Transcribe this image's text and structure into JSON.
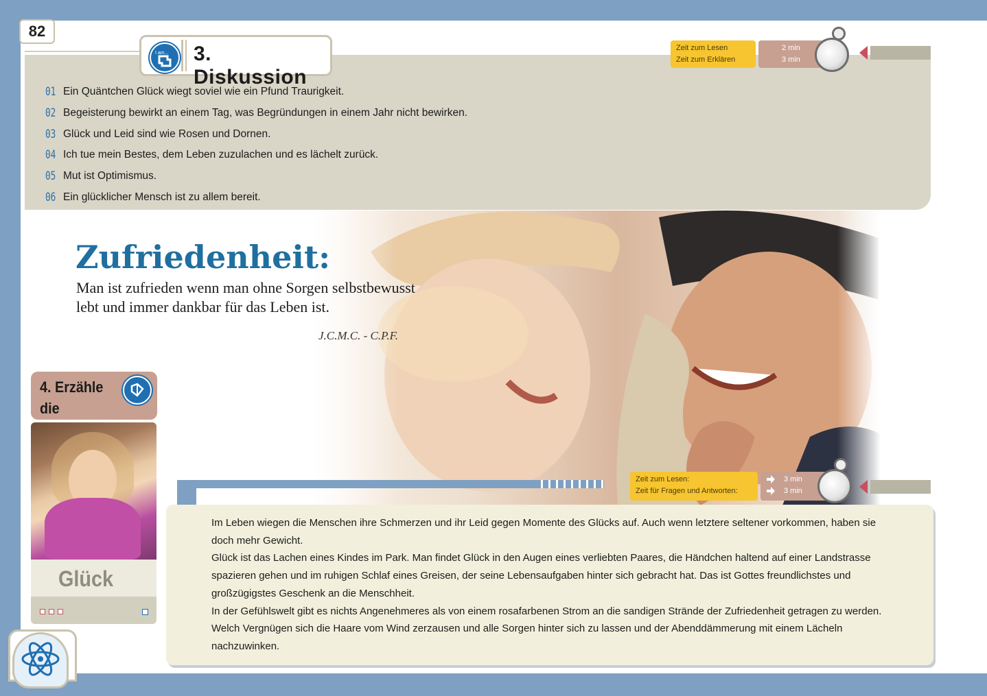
{
  "page_number": "82",
  "header": {
    "badge_icon_text": "I am...",
    "title": "3. Diskussion"
  },
  "timer_top": {
    "labels": [
      "Zeit zum Lesen",
      "Zeit zum Erklären"
    ],
    "values": [
      "2 min",
      "3 min"
    ]
  },
  "discussion_items": [
    {
      "num": "01",
      "text": "Ein Quäntchen Glück wiegt soviel wie ein Pfund Traurigkeit."
    },
    {
      "num": "02",
      "text": "Begeisterung bewirkt an einem Tag, was Begründungen in einem Jahr nicht bewirken."
    },
    {
      "num": "03",
      "text": "Glück und Leid sind wie Rosen und Dornen."
    },
    {
      "num": "04",
      "text": "Ich tue mein Bestes, dem Leben zuzulachen und es lächelt zurück."
    },
    {
      "num": "05",
      "text": "Mut ist Optimismus."
    },
    {
      "num": "06",
      "text": "Ein glücklicher Mensch ist zu allem bereit."
    }
  ],
  "quote": {
    "title": "Zufriedenheit:",
    "body": "Man ist zufrieden wenn man ohne Sorgen selbstbewusst lebt und immer dankbar für das Leben ist.",
    "author": "J.C.M.C. - C.P.F."
  },
  "story_card": {
    "title_line1": "4. Erzähle",
    "title_line2": "die Geschichte",
    "label": "Glück"
  },
  "timer_bottom": {
    "labels": [
      "Zeit zum Lesen:",
      "Zeit für Fragen und Antworten:"
    ],
    "values": [
      "3 min",
      "3 min"
    ]
  },
  "story_text": {
    "p1": "Im Leben wiegen die Menschen ihre Schmerzen und ihr Leid gegen Momente des Glücks auf.  Auch wenn letztere seltener vorkommen, haben sie doch mehr Gewicht.",
    "p2": "Glück ist das Lachen eines Kindes im Park. Man findet Glück in den Augen eines verliebten Paares, die Händchen haltend auf einer Landstrasse spazieren gehen und im ruhigen Schlaf eines Greisen, der seine Lebensaufgaben hinter sich gebracht hat. Das ist Gottes freundlichstes und großzügigstes Geschenk an die Menschheit.",
    "p3": "In der Gefühlswelt gibt es nichts Angenehmeres als von einem rosafarbenen Strom an die sandigen Strände der Zufriedenheit getragen zu werden.  Welch Vergnügen sich die Haare vom Wind zerzausen und alle Sorgen hinter sich zu lassen und der Abenddämmerung mit einem Lächeln nachzuwinken."
  },
  "colors": {
    "frame_blue": "#7ea0c2",
    "panel_beige": "#d9d6c8",
    "accent_blue": "#1f6fb2",
    "timer_yellow": "#f6c52f",
    "timer_rose": "#c7a091",
    "marker_red": "#c94f5c"
  },
  "icons": [
    "i-am-icon",
    "stopwatch-icon",
    "story-book-icon",
    "atom-head-icon",
    "arrow-right-icon"
  ]
}
